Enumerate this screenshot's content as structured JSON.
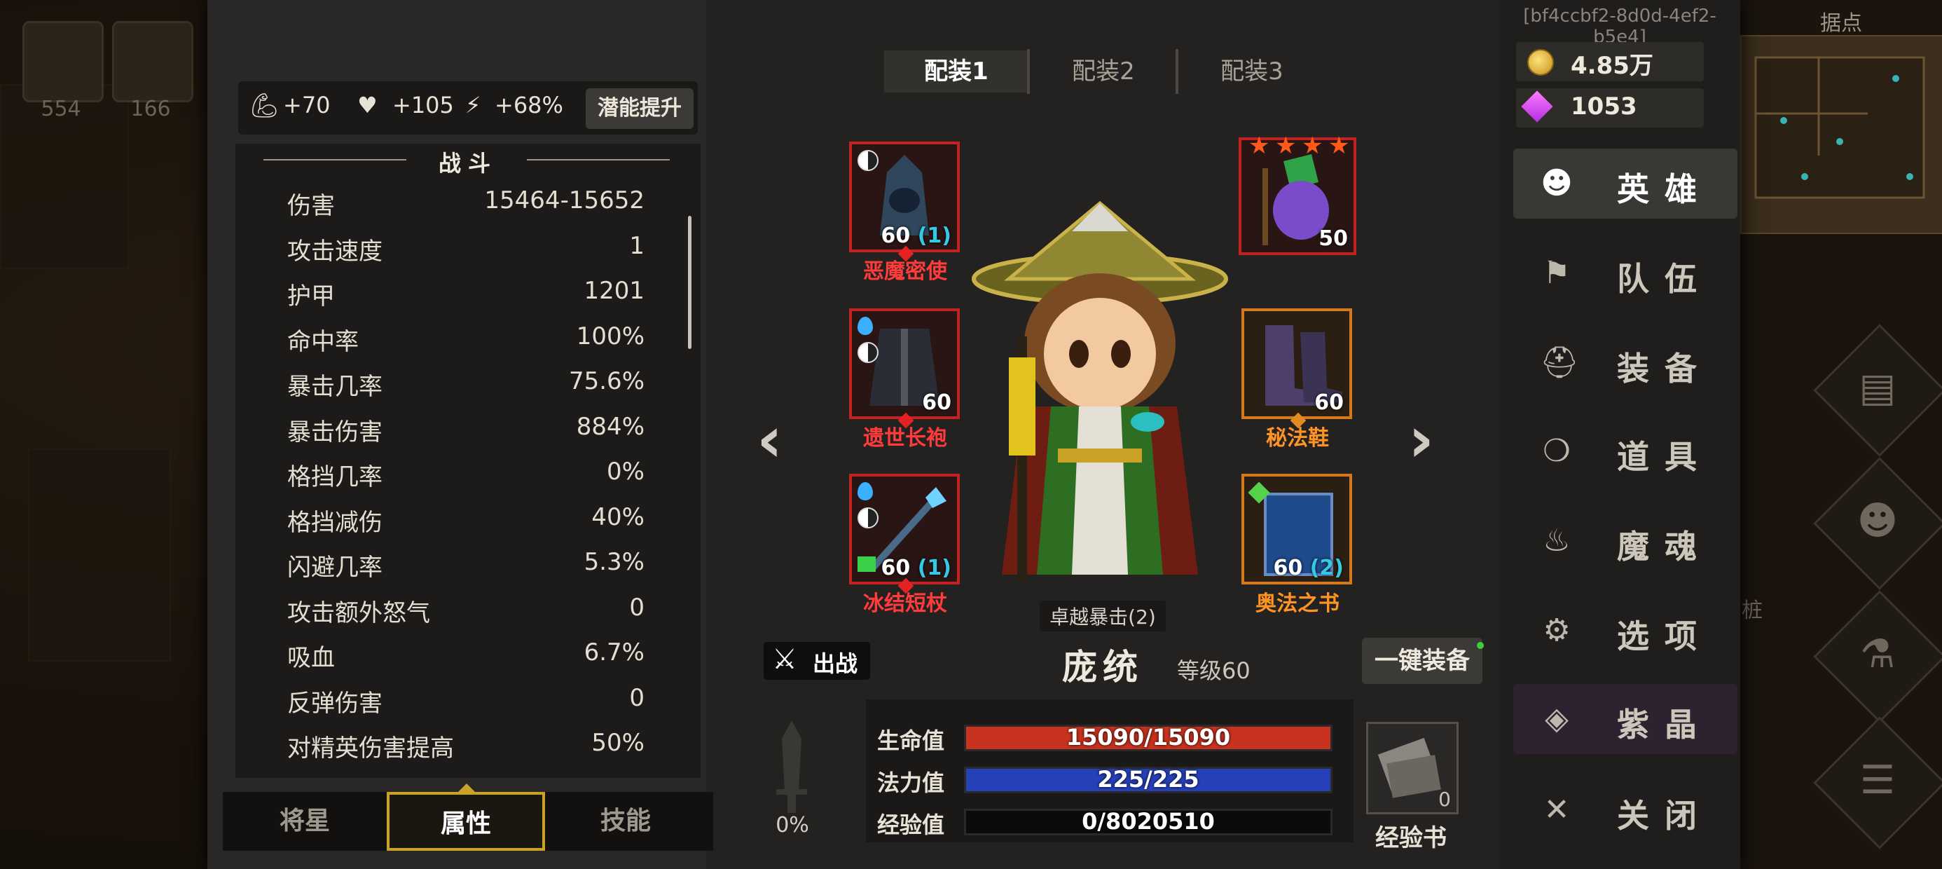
{
  "session_id": "[bf4ccbf2-8d0d-4ef2-b5e4]",
  "world": {
    "quick_counts": [
      "554",
      "166"
    ],
    "minimap_title": "据点",
    "side_label": "桩"
  },
  "potential": {
    "strength": "+70",
    "health": "+105",
    "energy": "+68%",
    "button": "潜能提升"
  },
  "stats": {
    "section_title": "战斗",
    "rows": [
      {
        "name": "伤害",
        "value": "15464-15652"
      },
      {
        "name": "攻击速度",
        "value": "1"
      },
      {
        "name": "护甲",
        "value": "1201"
      },
      {
        "name": "命中率",
        "value": "100%"
      },
      {
        "name": "暴击几率",
        "value": "75.6%"
      },
      {
        "name": "暴击伤害",
        "value": "884%"
      },
      {
        "name": "格挡几率",
        "value": "0%"
      },
      {
        "name": "格挡减伤",
        "value": "40%"
      },
      {
        "name": "闪避几率",
        "value": "5.3%"
      },
      {
        "name": "攻击额外怒气",
        "value": "0"
      },
      {
        "name": "吸血",
        "value": "6.7%"
      },
      {
        "name": "反弹伤害",
        "value": "0"
      },
      {
        "name": "对精英伤害提高",
        "value": "50%"
      }
    ]
  },
  "bottom_tabs": [
    "将星",
    "属性",
    "技能"
  ],
  "loadout_tabs": [
    "配装1",
    "配装2",
    "配装3"
  ],
  "equipment": {
    "helmet": {
      "name": "恶魔密使",
      "level": "60",
      "bonus": "(1)"
    },
    "pet": {
      "level": "50",
      "stars": 4
    },
    "armor": {
      "name": "遗世长袍",
      "level": "60"
    },
    "boots": {
      "name": "秘法鞋",
      "level": "60"
    },
    "weapon": {
      "name": "冰结短杖",
      "level": "60",
      "bonus": "(1)"
    },
    "book": {
      "name": "奥法之书",
      "level": "60",
      "bonus": "(2)"
    }
  },
  "hero": {
    "name": "庞统",
    "level": "等级60",
    "trait": "卓越暴击(2)",
    "deploy": "出战",
    "auto_equip": "一键装备"
  },
  "bars": {
    "hp_label": "生命值",
    "hp": "15090/15090",
    "hp_ratio": 1.0,
    "mp_label": "法力值",
    "mp": "225/225",
    "mp_ratio": 1.0,
    "exp_label": "经验值",
    "exp": "0/8020510",
    "exp_ratio": 0.0
  },
  "sword": {
    "percent": "0%"
  },
  "exp_book": {
    "label": "经验书",
    "count": "0"
  },
  "currency": {
    "gold": "4.85万",
    "crystal": "1053"
  },
  "nav": [
    {
      "label": "英雄",
      "icon": "users-icon"
    },
    {
      "label": "队伍",
      "icon": "flag-icon"
    },
    {
      "label": "装备",
      "icon": "helmet-icon"
    },
    {
      "label": "道具",
      "icon": "bag-icon"
    },
    {
      "label": "魔魂",
      "icon": "flame-icon"
    },
    {
      "label": "选项",
      "icon": "gear-icon"
    },
    {
      "label": "紫晶",
      "icon": "crystal-icon"
    },
    {
      "label": "关闭",
      "icon": "close-icon"
    }
  ],
  "colors": {
    "hp": "#c8321f",
    "mp": "#2640b8",
    "rare_red": "#ff3b3b",
    "rare_orange": "#ff9426",
    "accent_gold": "#c9a227"
  }
}
